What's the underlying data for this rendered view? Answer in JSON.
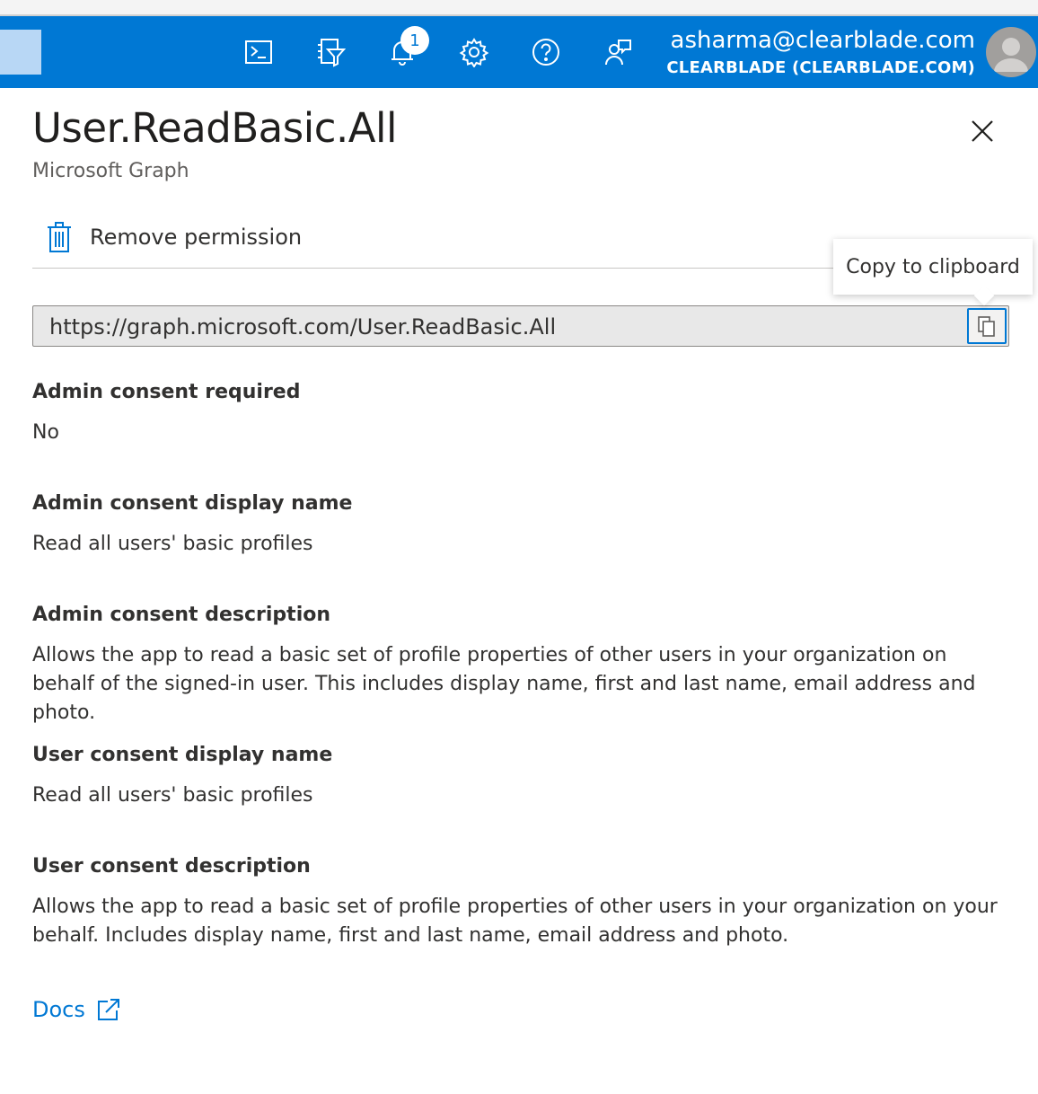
{
  "header": {
    "notification_count": "1",
    "account_email": "asharma@clearblade.com",
    "account_tenant": "CLEARBLADE (CLEARBLADE.COM)",
    "icons": [
      "cloud-shell-icon",
      "directory-filter-icon",
      "notifications-icon",
      "settings-icon",
      "help-icon",
      "feedback-icon"
    ]
  },
  "panel": {
    "title": "User.ReadBasic.All",
    "subtitle": "Microsoft Graph",
    "remove_label": "Remove permission",
    "tooltip": "Copy to clipboard",
    "url": "https://graph.microsoft.com/User.ReadBasic.All"
  },
  "fields": [
    {
      "label": "Admin consent required",
      "value": "No"
    },
    {
      "label": "Admin consent display name",
      "value": "Read all users' basic profiles"
    },
    {
      "label": "Admin consent description",
      "value": "Allows the app to read a basic set of profile properties of other users in your organization on behalf of the signed-in user. This includes display name, first and last name, email address and photo."
    },
    {
      "label": "User consent display name",
      "value": "Read all users' basic profiles"
    },
    {
      "label": "User consent description",
      "value": "Allows the app to read a basic set of profile properties of other users in your organization on your behalf. Includes display name, first and last name, email address and photo."
    }
  ],
  "docs_link": "Docs",
  "colors": {
    "accent": "#0078d4",
    "text": "#323130",
    "muted": "#605e5c"
  }
}
